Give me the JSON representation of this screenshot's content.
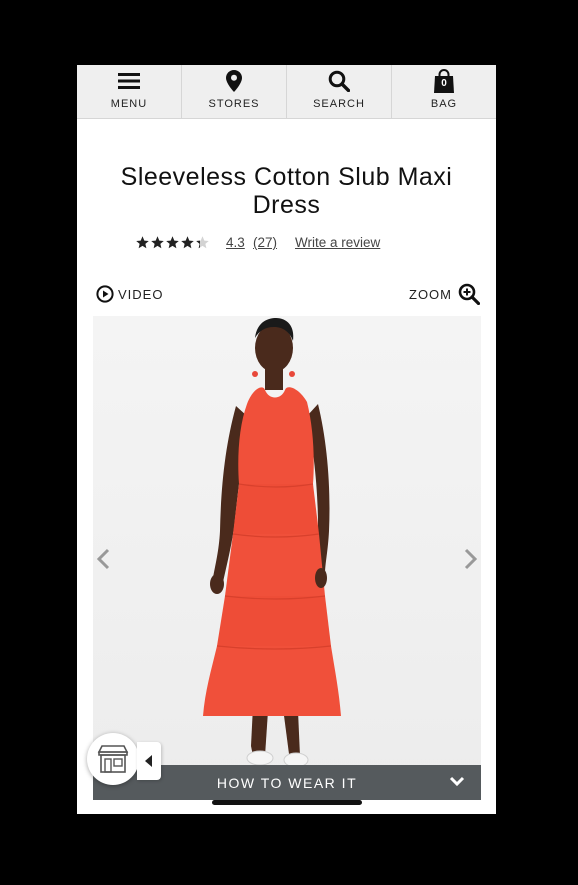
{
  "nav": {
    "items": [
      {
        "label": "MENU",
        "icon": "hamburger-icon"
      },
      {
        "label": "STORES",
        "icon": "map-pin-icon"
      },
      {
        "label": "SEARCH",
        "icon": "search-icon"
      },
      {
        "label": "BAG",
        "icon": "bag-icon"
      }
    ],
    "bag_count": "0"
  },
  "product": {
    "title": "Sleeveless Cotton Slub Maxi Dress",
    "rating": "4.3",
    "rating_fraction": 0.86,
    "review_count": "(27)",
    "write_review": "Write a review"
  },
  "media": {
    "video_label": "VIDEO",
    "zoom_label": "ZOOM",
    "how_to_wear": "HOW TO WEAR IT"
  },
  "colors": {
    "dress": "#f0503a",
    "nav_bg": "#efefef",
    "bar_bg": "#555a5d"
  }
}
